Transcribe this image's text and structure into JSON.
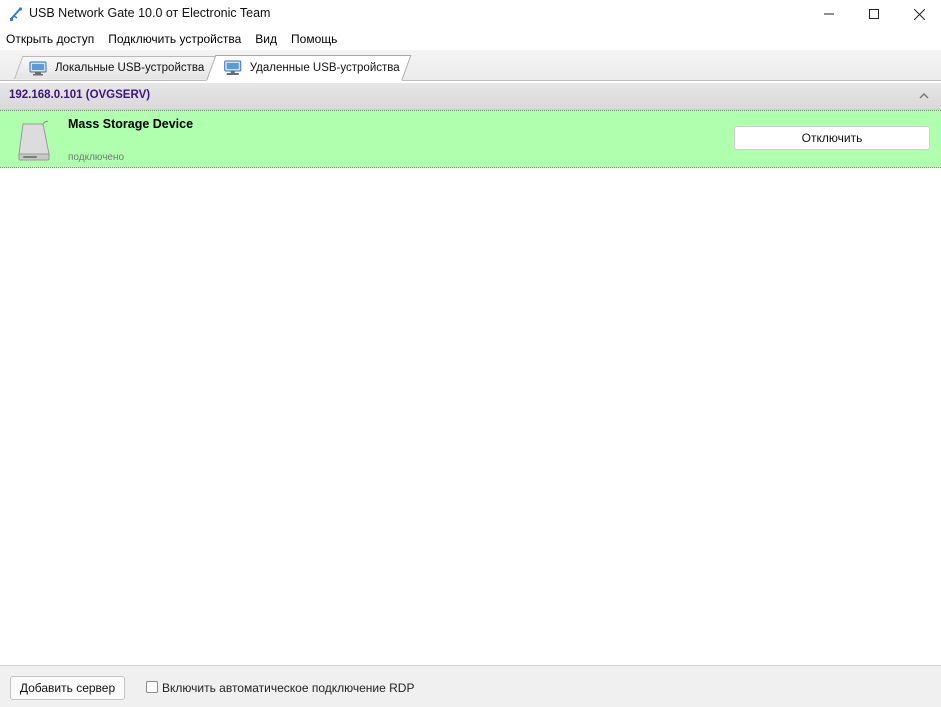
{
  "window": {
    "title": "USB Network Gate 10.0 от Electronic Team",
    "icons": [
      "usb-app-icon",
      "minimize-icon",
      "maximize-icon",
      "close-icon"
    ]
  },
  "menu": {
    "items": [
      "Открыть доступ",
      "Подключить устройства",
      "Вид",
      "Помощь"
    ]
  },
  "tabs": {
    "local_label": "Локальные USB-устройства",
    "remote_label": "Удаленные USB-устройства",
    "active": "remote"
  },
  "server": {
    "name": "192.168.0.101 (OVGSERV)",
    "name_color": "#3a1580"
  },
  "device": {
    "name": "Mass Storage Device",
    "status": "подключено",
    "disconnect_label": "Отключить",
    "row_color": "#afffaf",
    "icon": "hard-drive-icon"
  },
  "footer": {
    "add_server_label": "Добавить сервер",
    "rdp_label": "Включить автоматическое подключение RDP",
    "rdp_checked": false
  }
}
